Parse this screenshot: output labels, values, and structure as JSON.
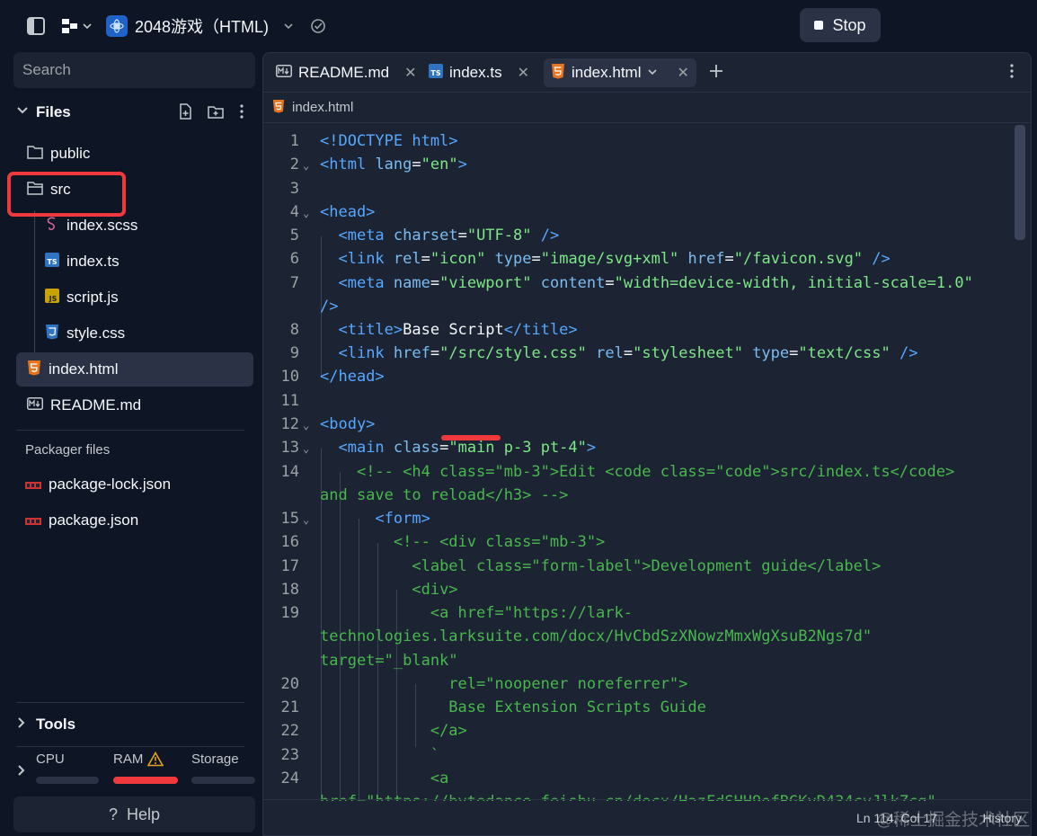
{
  "topbar": {
    "repl_name": "2048游戏（HTML)",
    "stop_label": "Stop"
  },
  "sidebar": {
    "search_placeholder": "Search",
    "files_title": "Files",
    "tree": [
      {
        "label": "public",
        "icon": "folder-icon"
      },
      {
        "label": "src",
        "icon": "folder-open-icon"
      },
      {
        "label": "index.scss",
        "icon": "sass-icon"
      },
      {
        "label": "index.ts",
        "icon": "typescript-icon"
      },
      {
        "label": "script.js",
        "icon": "javascript-icon"
      },
      {
        "label": "style.css",
        "icon": "css-icon"
      },
      {
        "label": "index.html",
        "icon": "html-icon"
      },
      {
        "label": "README.md",
        "icon": "markdown-icon"
      }
    ],
    "packager_label": "Packager files",
    "packager": [
      {
        "label": "package-lock.json",
        "icon": "npm-icon"
      },
      {
        "label": "package.json",
        "icon": "npm-icon"
      }
    ],
    "tools_label": "Tools",
    "metrics": {
      "cpu": "CPU",
      "ram": "RAM",
      "storage": "Storage",
      "ram_level": 1.0
    },
    "help_label": "Help"
  },
  "editor": {
    "tabs": [
      {
        "label": "README.md",
        "icon": "markdown-icon"
      },
      {
        "label": "index.ts",
        "icon": "typescript-icon"
      },
      {
        "label": "index.html",
        "icon": "html-icon",
        "active": true
      }
    ],
    "breadcrumb": "index.html",
    "status_position": "Ln 114, Col 17",
    "history_label": "History",
    "watermark": "@稀土掘金技术社区"
  },
  "colors": {
    "background": "#0e1525",
    "panel": "#1c2333",
    "annotation": "#f0393d",
    "tag": "#56a8ff",
    "string": "#7ee787",
    "comment": "#48b84d"
  }
}
